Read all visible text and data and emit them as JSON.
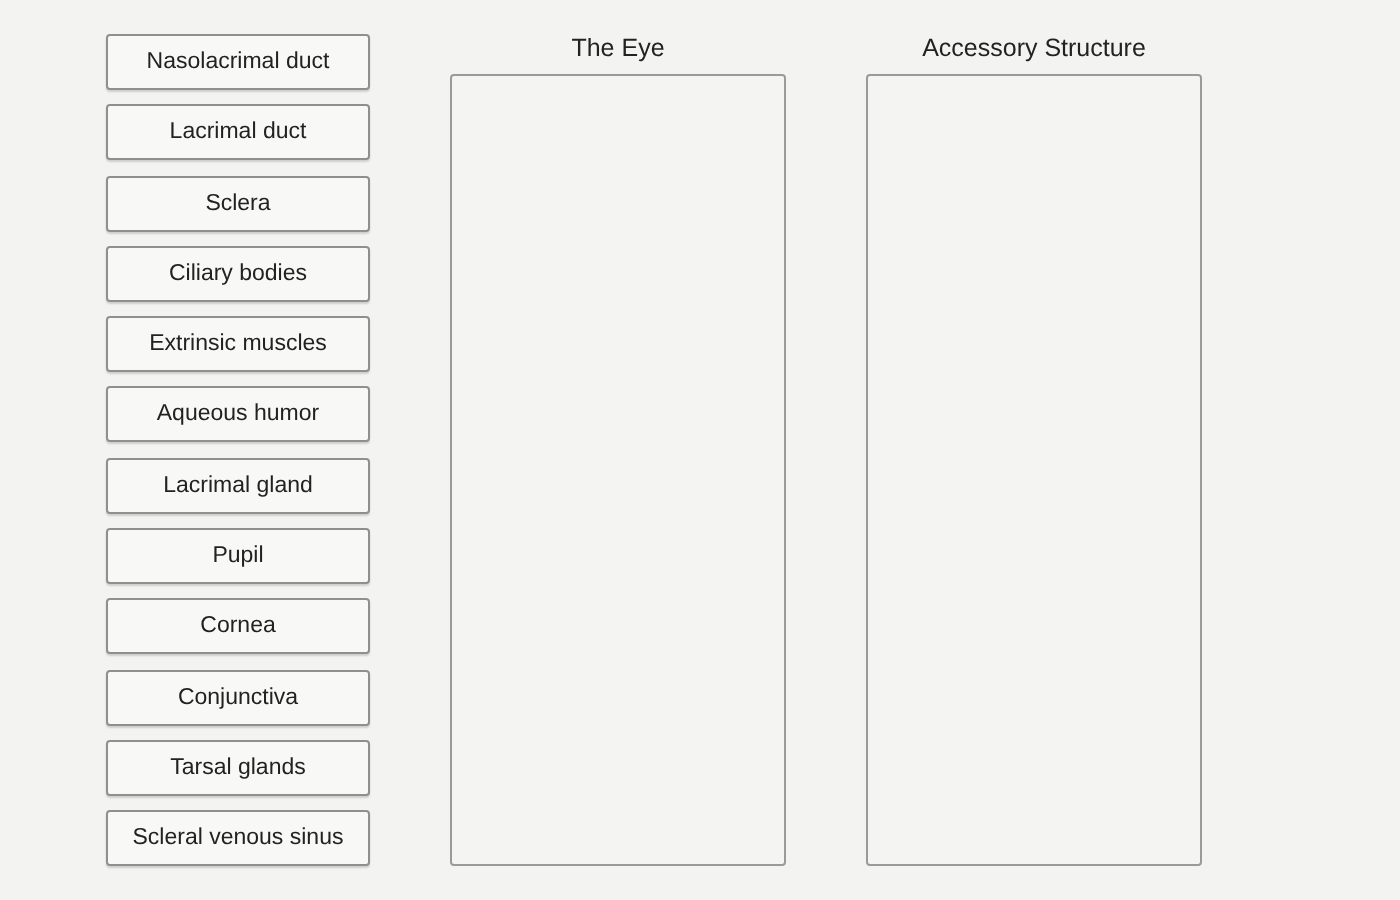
{
  "items": [
    {
      "label": "Nasolacrimal duct"
    },
    {
      "label": "Lacrimal duct"
    },
    {
      "label": "Sclera"
    },
    {
      "label": "Ciliary bodies"
    },
    {
      "label": "Extrinsic muscles"
    },
    {
      "label": "Aqueous humor"
    },
    {
      "label": "Lacrimal gland"
    },
    {
      "label": "Pupil"
    },
    {
      "label": "Cornea"
    },
    {
      "label": "Conjunctiva"
    },
    {
      "label": "Tarsal glands"
    },
    {
      "label": "Scleral venous sinus"
    }
  ],
  "targets": [
    {
      "title": "The Eye"
    },
    {
      "title": "Accessory Structure"
    }
  ]
}
